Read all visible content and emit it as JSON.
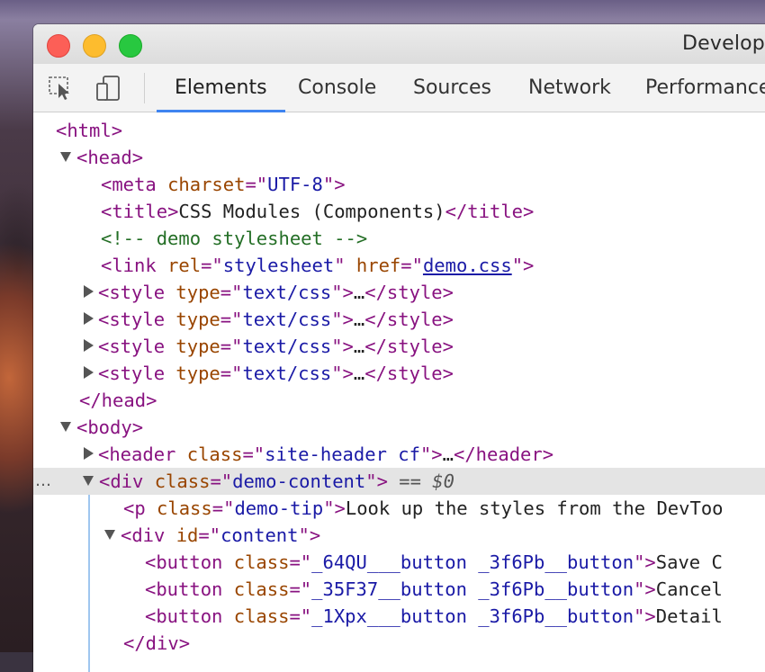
{
  "window": {
    "title": "Develop"
  },
  "toolbar": {
    "inspect_icon": "inspect-element-icon",
    "device_icon": "device-toolbar-icon",
    "tabs": [
      {
        "label": "Elements",
        "active": true
      },
      {
        "label": "Console"
      },
      {
        "label": "Sources"
      },
      {
        "label": "Network"
      },
      {
        "label": "Performance"
      }
    ]
  },
  "dom": {
    "html_open": "html",
    "head_open": "head",
    "meta": {
      "tag": "meta",
      "attr": "charset",
      "value": "UTF-8"
    },
    "title": {
      "tag": "title",
      "text": "CSS Modules (Components)",
      "close": "/title"
    },
    "comment": "<!-- demo stylesheet -->",
    "link": {
      "tag": "link",
      "attr1": "rel",
      "val1": "stylesheet",
      "attr2": "href",
      "val2": "demo.css"
    },
    "styles": [
      {
        "tag": "style",
        "attr": "type",
        "value": "text/css",
        "ellipsis": "…",
        "close": "/style"
      },
      {
        "tag": "style",
        "attr": "type",
        "value": "text/css",
        "ellipsis": "…",
        "close": "/style"
      },
      {
        "tag": "style",
        "attr": "type",
        "value": "text/css",
        "ellipsis": "…",
        "close": "/style"
      },
      {
        "tag": "style",
        "attr": "type",
        "value": "text/css",
        "ellipsis": "…",
        "close": "/style"
      }
    ],
    "head_close": "/head",
    "body_open": "body",
    "header": {
      "tag": "header",
      "attr": "class",
      "value": "site-header cf",
      "ellipsis": "…",
      "close": "/header"
    },
    "div": {
      "tag": "div",
      "attr": "class",
      "value": "demo-content",
      "eq": "==",
      "var": "$0",
      "dots": "…"
    },
    "p": {
      "tag": "p",
      "attr": "class",
      "value": "demo-tip",
      "text": "Look up the styles from the DevToo"
    },
    "content": {
      "tag": "div",
      "attr": "id",
      "value": "content"
    },
    "buttons": [
      {
        "tag": "button",
        "attr": "class",
        "value": "_64QU___button _3f6Pb__button",
        "text": "Save C"
      },
      {
        "tag": "button",
        "attr": "class",
        "value": "_35F37__button _3f6Pb__button",
        "text": "Cancel"
      },
      {
        "tag": "button",
        "attr": "class",
        "value": "_1Xpx___button _3f6Pb__button",
        "text": "Detail"
      }
    ],
    "div_close": "/div"
  }
}
